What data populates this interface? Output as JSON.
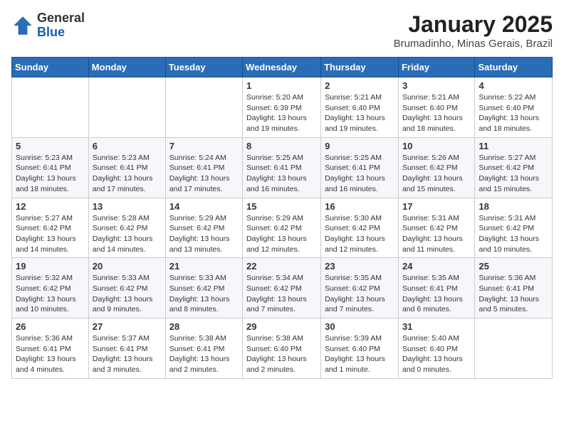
{
  "logo": {
    "general": "General",
    "blue": "Blue"
  },
  "title": "January 2025",
  "subtitle": "Brumadinho, Minas Gerais, Brazil",
  "days_of_week": [
    "Sunday",
    "Monday",
    "Tuesday",
    "Wednesday",
    "Thursday",
    "Friday",
    "Saturday"
  ],
  "weeks": [
    [
      {
        "num": "",
        "info": ""
      },
      {
        "num": "",
        "info": ""
      },
      {
        "num": "",
        "info": ""
      },
      {
        "num": "1",
        "info": "Sunrise: 5:20 AM\nSunset: 6:39 PM\nDaylight: 13 hours and 19 minutes."
      },
      {
        "num": "2",
        "info": "Sunrise: 5:21 AM\nSunset: 6:40 PM\nDaylight: 13 hours and 19 minutes."
      },
      {
        "num": "3",
        "info": "Sunrise: 5:21 AM\nSunset: 6:40 PM\nDaylight: 13 hours and 18 minutes."
      },
      {
        "num": "4",
        "info": "Sunrise: 5:22 AM\nSunset: 6:40 PM\nDaylight: 13 hours and 18 minutes."
      }
    ],
    [
      {
        "num": "5",
        "info": "Sunrise: 5:23 AM\nSunset: 6:41 PM\nDaylight: 13 hours and 18 minutes."
      },
      {
        "num": "6",
        "info": "Sunrise: 5:23 AM\nSunset: 6:41 PM\nDaylight: 13 hours and 17 minutes."
      },
      {
        "num": "7",
        "info": "Sunrise: 5:24 AM\nSunset: 6:41 PM\nDaylight: 13 hours and 17 minutes."
      },
      {
        "num": "8",
        "info": "Sunrise: 5:25 AM\nSunset: 6:41 PM\nDaylight: 13 hours and 16 minutes."
      },
      {
        "num": "9",
        "info": "Sunrise: 5:25 AM\nSunset: 6:41 PM\nDaylight: 13 hours and 16 minutes."
      },
      {
        "num": "10",
        "info": "Sunrise: 5:26 AM\nSunset: 6:42 PM\nDaylight: 13 hours and 15 minutes."
      },
      {
        "num": "11",
        "info": "Sunrise: 5:27 AM\nSunset: 6:42 PM\nDaylight: 13 hours and 15 minutes."
      }
    ],
    [
      {
        "num": "12",
        "info": "Sunrise: 5:27 AM\nSunset: 6:42 PM\nDaylight: 13 hours and 14 minutes."
      },
      {
        "num": "13",
        "info": "Sunrise: 5:28 AM\nSunset: 6:42 PM\nDaylight: 13 hours and 14 minutes."
      },
      {
        "num": "14",
        "info": "Sunrise: 5:29 AM\nSunset: 6:42 PM\nDaylight: 13 hours and 13 minutes."
      },
      {
        "num": "15",
        "info": "Sunrise: 5:29 AM\nSunset: 6:42 PM\nDaylight: 13 hours and 12 minutes."
      },
      {
        "num": "16",
        "info": "Sunrise: 5:30 AM\nSunset: 6:42 PM\nDaylight: 13 hours and 12 minutes."
      },
      {
        "num": "17",
        "info": "Sunrise: 5:31 AM\nSunset: 6:42 PM\nDaylight: 13 hours and 11 minutes."
      },
      {
        "num": "18",
        "info": "Sunrise: 5:31 AM\nSunset: 6:42 PM\nDaylight: 13 hours and 10 minutes."
      }
    ],
    [
      {
        "num": "19",
        "info": "Sunrise: 5:32 AM\nSunset: 6:42 PM\nDaylight: 13 hours and 10 minutes."
      },
      {
        "num": "20",
        "info": "Sunrise: 5:33 AM\nSunset: 6:42 PM\nDaylight: 13 hours and 9 minutes."
      },
      {
        "num": "21",
        "info": "Sunrise: 5:33 AM\nSunset: 6:42 PM\nDaylight: 13 hours and 8 minutes."
      },
      {
        "num": "22",
        "info": "Sunrise: 5:34 AM\nSunset: 6:42 PM\nDaylight: 13 hours and 7 minutes."
      },
      {
        "num": "23",
        "info": "Sunrise: 5:35 AM\nSunset: 6:42 PM\nDaylight: 13 hours and 7 minutes."
      },
      {
        "num": "24",
        "info": "Sunrise: 5:35 AM\nSunset: 6:41 PM\nDaylight: 13 hours and 6 minutes."
      },
      {
        "num": "25",
        "info": "Sunrise: 5:36 AM\nSunset: 6:41 PM\nDaylight: 13 hours and 5 minutes."
      }
    ],
    [
      {
        "num": "26",
        "info": "Sunrise: 5:36 AM\nSunset: 6:41 PM\nDaylight: 13 hours and 4 minutes."
      },
      {
        "num": "27",
        "info": "Sunrise: 5:37 AM\nSunset: 6:41 PM\nDaylight: 13 hours and 3 minutes."
      },
      {
        "num": "28",
        "info": "Sunrise: 5:38 AM\nSunset: 6:41 PM\nDaylight: 13 hours and 2 minutes."
      },
      {
        "num": "29",
        "info": "Sunrise: 5:38 AM\nSunset: 6:40 PM\nDaylight: 13 hours and 2 minutes."
      },
      {
        "num": "30",
        "info": "Sunrise: 5:39 AM\nSunset: 6:40 PM\nDaylight: 13 hours and 1 minute."
      },
      {
        "num": "31",
        "info": "Sunrise: 5:40 AM\nSunset: 6:40 PM\nDaylight: 13 hours and 0 minutes."
      },
      {
        "num": "",
        "info": ""
      }
    ]
  ]
}
